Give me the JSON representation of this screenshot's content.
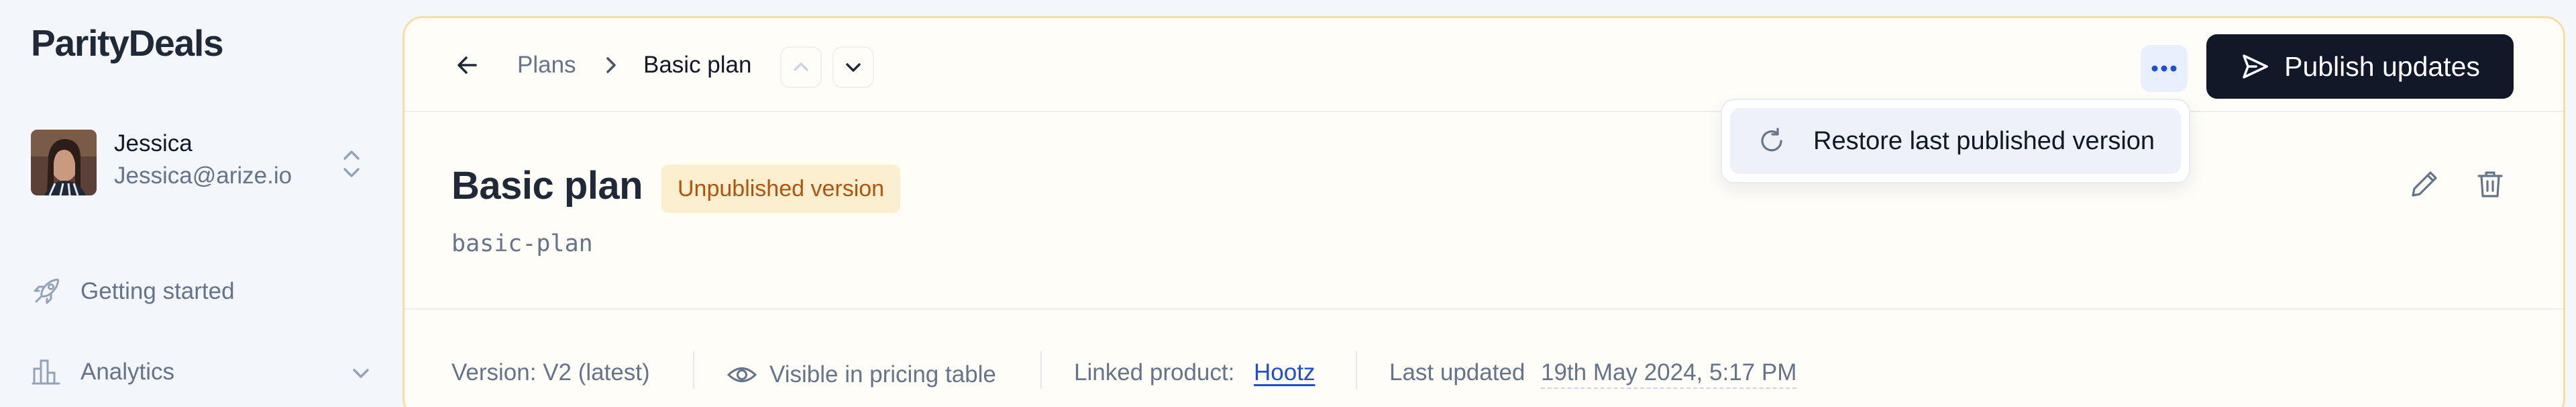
{
  "brand": "ParityDeals",
  "user": {
    "name": "Jessica",
    "email": "Jessica@arize.io"
  },
  "nav": {
    "getting_started": "Getting started",
    "analytics": "Analytics"
  },
  "breadcrumb": {
    "parent": "Plans",
    "current": "Basic plan"
  },
  "actions": {
    "publish_label": "Publish updates"
  },
  "menu": {
    "restore_label": "Restore last published version"
  },
  "plan": {
    "title": "Basic plan",
    "status_badge": "Unpublished version",
    "slug": "basic-plan"
  },
  "meta": {
    "version": "Version: V2 (latest)",
    "visibility": "Visible in pricing table",
    "linked_label": "Linked product:",
    "linked_value": "Hootz",
    "updated_label": "Last updated",
    "updated_value": "19th May 2024, 5:17 PM"
  },
  "colors": {
    "accent_dark": "#111827",
    "badge_bg": "#fcefd0",
    "badge_text": "#b45309",
    "link": "#1d4ed8",
    "panel_border": "#f7dea0"
  },
  "icons": {
    "back": "arrow-left-icon",
    "breadcrumb_sep": "chevron-right-icon",
    "prev": "chevron-up-icon",
    "next": "chevron-down-icon",
    "more": "more-horizontal-icon",
    "publish": "send-icon",
    "restore": "refresh-icon",
    "edit": "pencil-icon",
    "delete": "trash-icon",
    "visible": "eye-icon",
    "getting_started": "rocket-icon",
    "analytics": "bar-chart-icon",
    "user_switch": "chevrons-up-down-icon"
  }
}
